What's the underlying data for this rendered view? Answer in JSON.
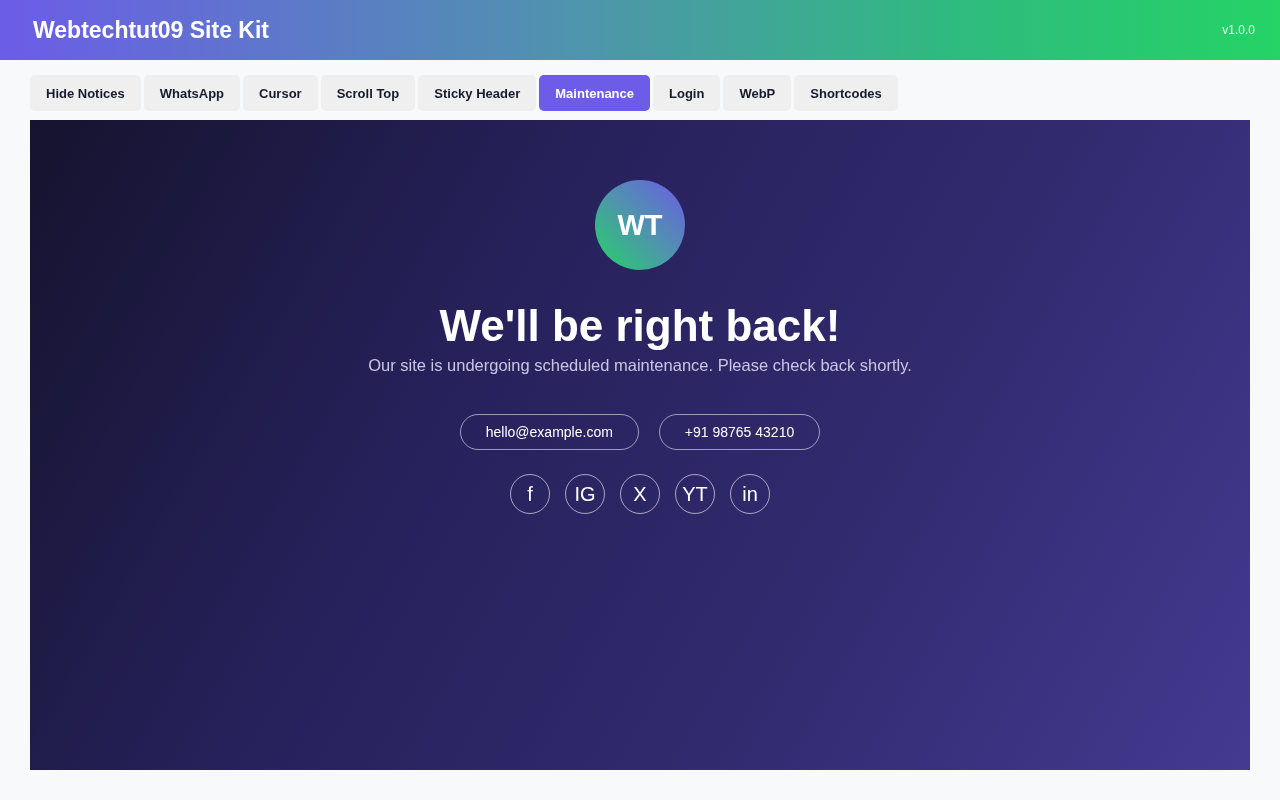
{
  "header": {
    "title": "Webtechtut09 Site Kit",
    "version": "v1.0.0"
  },
  "tabs": [
    {
      "label": "Hide Notices",
      "selected": false
    },
    {
      "label": "WhatsApp",
      "selected": false
    },
    {
      "label": "Cursor",
      "selected": false
    },
    {
      "label": "Scroll Top",
      "selected": false
    },
    {
      "label": "Sticky Header",
      "selected": false
    },
    {
      "label": "Maintenance",
      "selected": true
    },
    {
      "label": "Login",
      "selected": false
    },
    {
      "label": "WebP",
      "selected": false
    },
    {
      "label": "Shortcodes",
      "selected": false
    }
  ],
  "preview": {
    "logo": "WT",
    "heading": "We'll be right back!",
    "message": "Our site is undergoing scheduled maintenance. Please check back shortly.",
    "contacts": [
      "hello@example.com",
      "+91 98765 43210"
    ],
    "social": [
      "f",
      "IG",
      "X",
      "YT",
      "in"
    ]
  }
}
